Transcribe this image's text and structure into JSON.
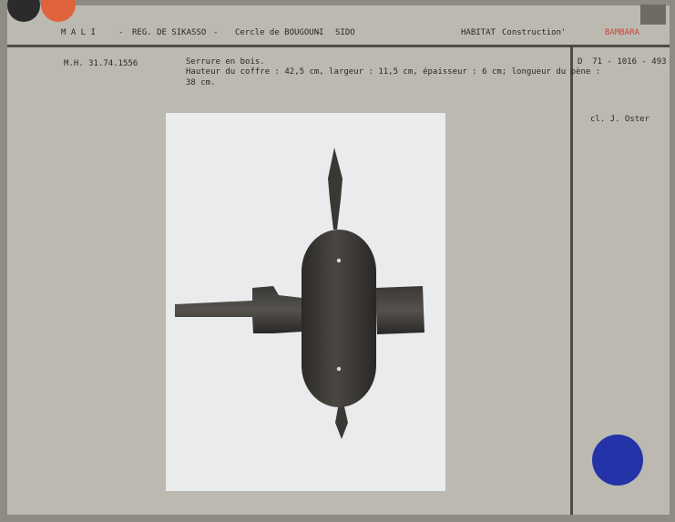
{
  "header": {
    "country": "M A L I",
    "sep1": "-",
    "region": "REG. DE SIKASSO",
    "sep2": "-",
    "cercle": "Cercle de BOUGOUNI",
    "sep3": "-",
    "village": "SIDO",
    "category": "HABITAT",
    "subcategory": "Construction",
    "tick": "'",
    "ethnic_group": "BAMBARA"
  },
  "record": {
    "inventory_number": "M.H. 31.74.1556",
    "title": "Serrure en bois.",
    "dimensions_line1": "Hauteur du coffre : 42,5 cm, largeur : 11,5 cm, épaisseur : 6 cm; longueur du pène :",
    "dimensions_line2": "38 cm.",
    "negative_number": "D  71 - 1016 - 493",
    "photo_credit": "cl. J. Oster"
  },
  "colors": {
    "dot_dark": "#2b2b2b",
    "dot_orange": "#e0623b",
    "dot_blue": "#2433a8",
    "ethnic_red": "#c9463a"
  }
}
